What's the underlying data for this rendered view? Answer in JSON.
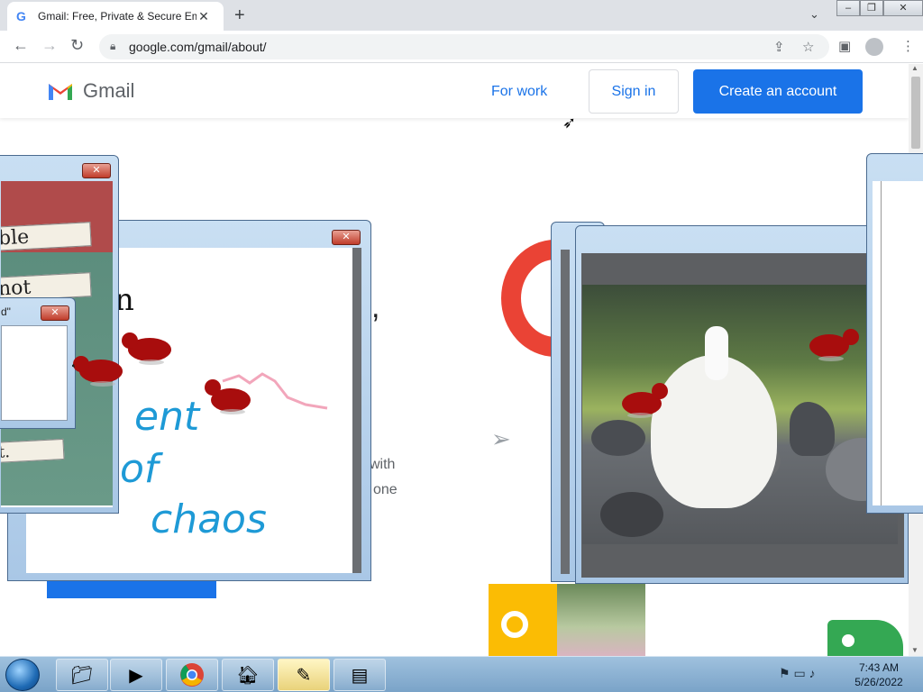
{
  "browser": {
    "tab_title": "Gmail: Free, Private & Secure Em",
    "tab_favicon": "G",
    "tab_close": "✕",
    "new_tab": "+",
    "url": "google.com/gmail/about/",
    "window_controls": [
      "–",
      "❐",
      "✕"
    ]
  },
  "gmail_header": {
    "brand": "Gmail",
    "for_work": "For work",
    "sign_in": "Sign in",
    "create_account": "Create an account"
  },
  "page_fragments": {
    "comma": ",",
    "with": "with",
    "one": "one"
  },
  "popups": {
    "left_small_title": "d\"",
    "papers": [
      "ble",
      "not",
      "t."
    ],
    "handwriting": [
      "n",
      "ent",
      "of",
      "chaos"
    ]
  },
  "taskbar": {
    "time": "7:43 AM",
    "date": "5/26/2022"
  },
  "colors": {
    "accent": "#1a73e8",
    "gmail_red": "#ea4335",
    "bird_red": "#a80d0d",
    "chaos_blue": "#1e9ad6"
  },
  "icons": [
    "back-icon",
    "forward-icon",
    "reload-icon",
    "lock-icon",
    "share-icon",
    "star-icon",
    "sidepanel-icon",
    "profile-icon",
    "menu-icon",
    "send-icon",
    "cursor-icon"
  ]
}
